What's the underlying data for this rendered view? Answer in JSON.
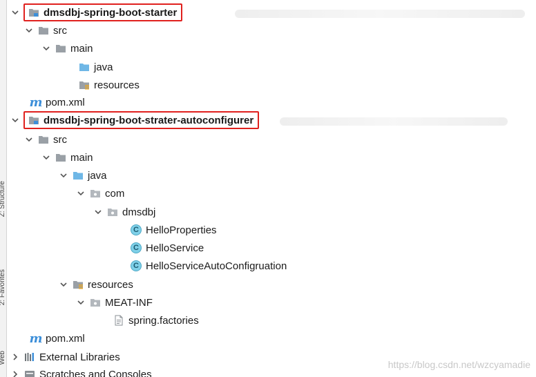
{
  "side_tabs": {
    "structure": "Z: Structure",
    "favorites": "2: Favorites",
    "web": "Web"
  },
  "tree": {
    "module1": "dmsdbj-spring-boot-starter",
    "src1": "src",
    "main1": "main",
    "java1": "java",
    "resources1": "resources",
    "pom1": "pom.xml",
    "module2": "dmsdbj-spring-boot-strater-autoconfigurer",
    "src2": "src",
    "main2": "main",
    "java2": "java",
    "com": "com",
    "dmsdbj": "dmsdbj",
    "class1": "HelloProperties",
    "class2": "HelloService",
    "class3": "HelloServiceAutoConfigruation",
    "resources2": "resources",
    "meta_inf": "MEAT-INF",
    "factories": "spring.factories",
    "pom2": "pom.xml",
    "external_libraries": "External Libraries",
    "scratches": "Scratches and Consoles"
  },
  "class_icon_letter": "C",
  "pom_icon_letter": "m",
  "watermark": "https://blog.csdn.net/wzcyamadie",
  "colors": {
    "highlight": "#e0201d",
    "folder_blue": "#6fb7e6",
    "folder_gray": "#9aa0a6"
  }
}
